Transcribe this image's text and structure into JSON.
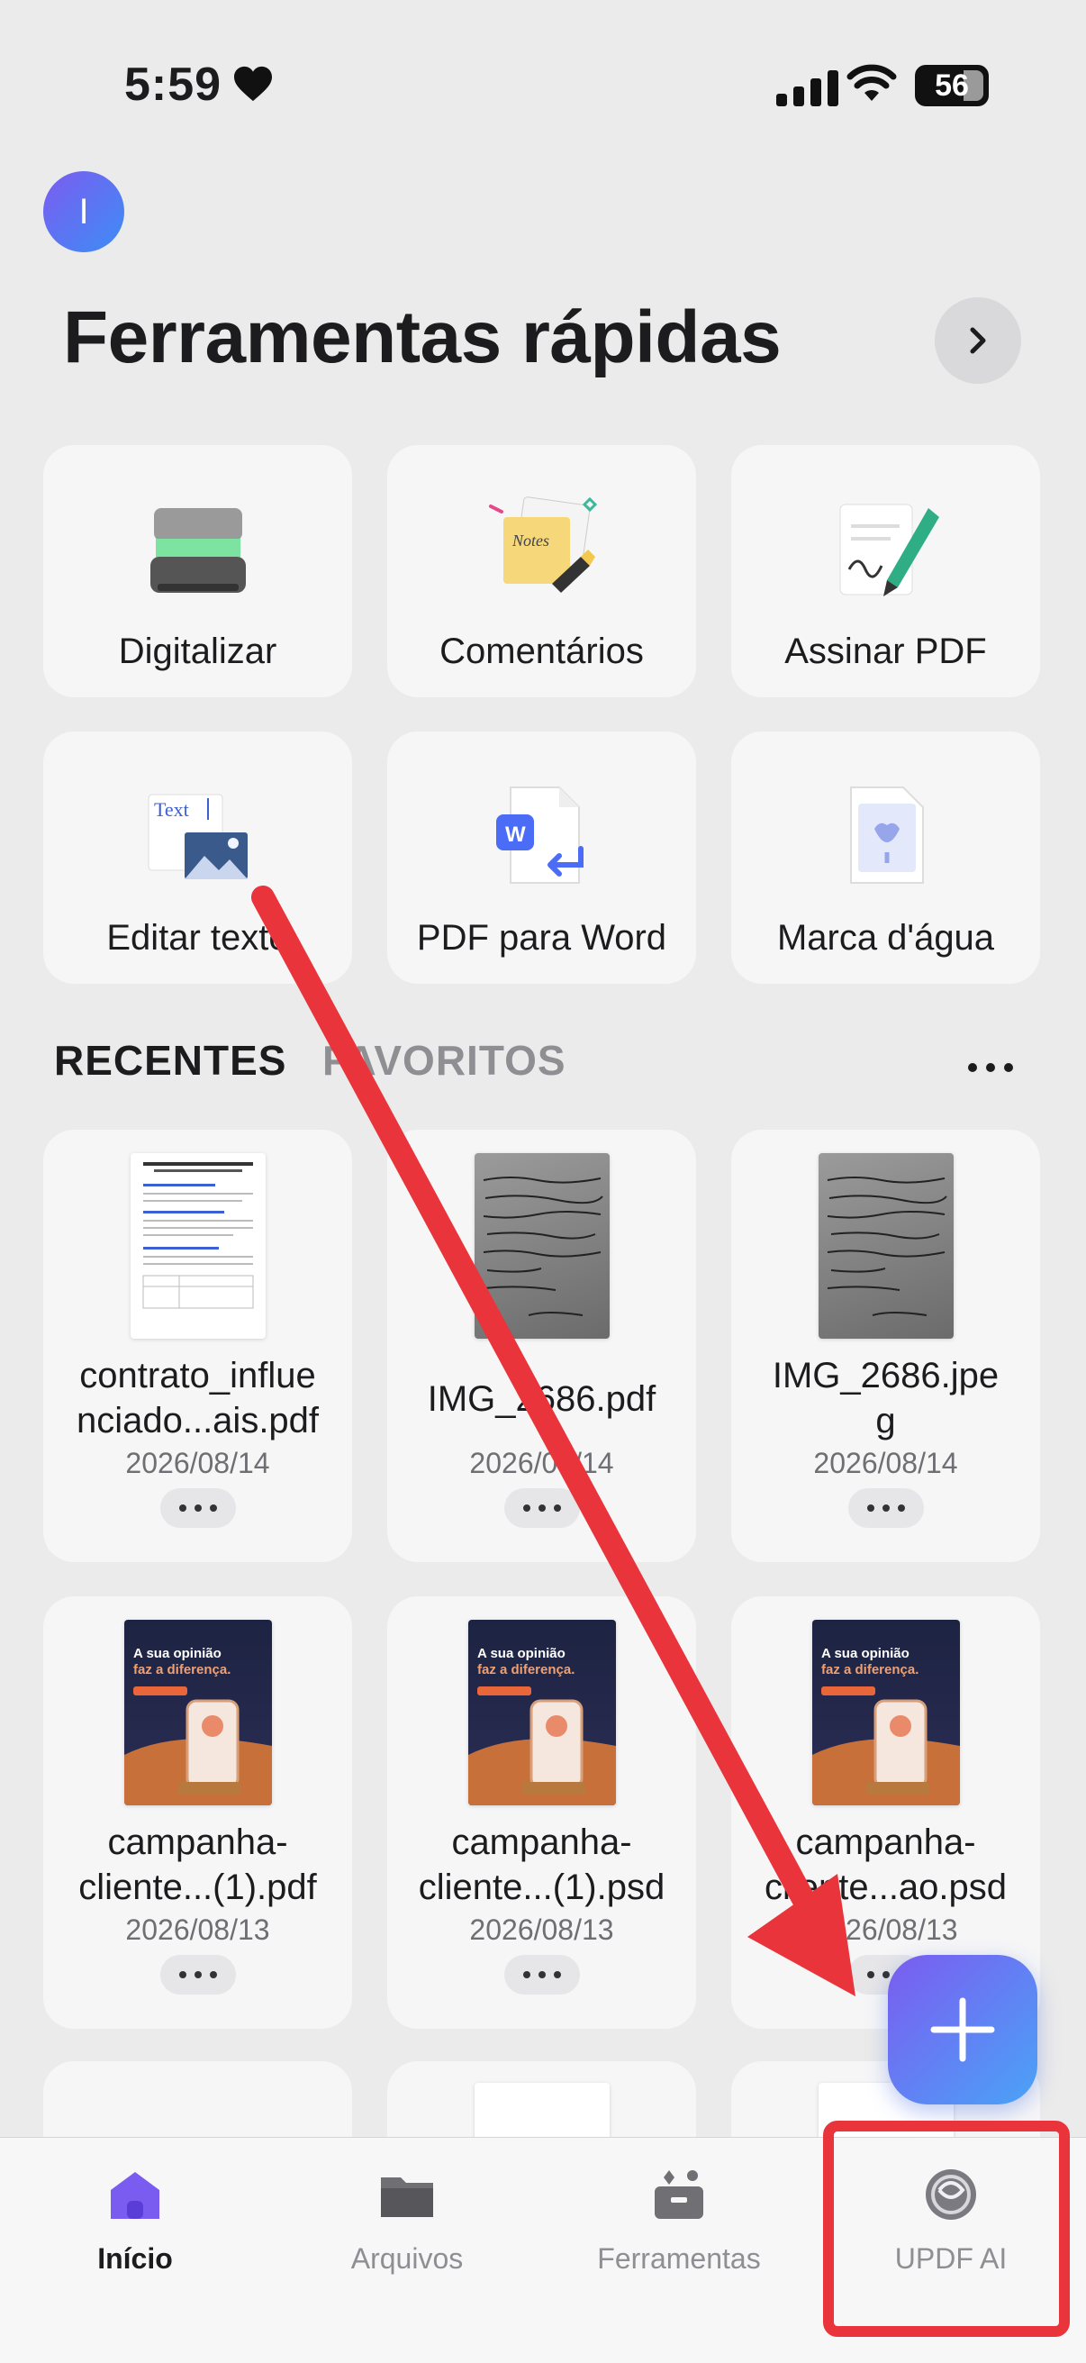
{
  "status_bar": {
    "time": "5:59",
    "battery": "56"
  },
  "header": {
    "avatar_initial": "I",
    "title": "Ferramentas rápidas"
  },
  "tools": [
    {
      "label": "Digitalizar",
      "icon": "scanner-icon"
    },
    {
      "label": "Comentários",
      "icon": "notes-icon"
    },
    {
      "label": "Assinar PDF",
      "icon": "signature-pen-icon"
    },
    {
      "label": "Editar texto",
      "icon": "edit-text-icon",
      "thumb_text": "Text"
    },
    {
      "label": "PDF para Word",
      "icon": "pdf-to-word-icon",
      "badge": "W"
    },
    {
      "label": "Marca d'água",
      "icon": "watermark-icon"
    }
  ],
  "tabs": {
    "recent": "RECENTES",
    "favorites": "FAVORITOS"
  },
  "files": [
    {
      "name": "contrato_influe\nnciado...ais.pdf",
      "date": "2026/08/14",
      "kind": "doc"
    },
    {
      "name": "IMG_2686.pdf",
      "date": "2026/08/14",
      "kind": "photo"
    },
    {
      "name": "IMG_2686.jpe\ng",
      "date": "2026/08/14",
      "kind": "photo"
    },
    {
      "name": "campanha-\ncliente...(1).pdf",
      "date": "2026/08/13",
      "kind": "flyer"
    },
    {
      "name": "campanha-\ncliente...(1).psd",
      "date": "2026/08/13",
      "kind": "flyer"
    },
    {
      "name": "campanha-\ncliente...ao.psd",
      "date": "2026/08/13",
      "kind": "flyer"
    }
  ],
  "flyer_text": {
    "line1": "A sua opinião",
    "line2": "faz a diferença."
  },
  "nav": [
    {
      "label": "Início",
      "icon": "home-icon",
      "active": true
    },
    {
      "label": "Arquivos",
      "icon": "folder-icon",
      "active": false
    },
    {
      "label": "Ferramentas",
      "icon": "toolbox-icon",
      "active": false
    },
    {
      "label": "UPDF AI",
      "icon": "ai-icon",
      "active": false
    }
  ],
  "colors": {
    "accent": "#7b5cf0",
    "accent2": "#4aa3f7",
    "annotation_red": "#e8343a",
    "background": "#ebebeb"
  }
}
